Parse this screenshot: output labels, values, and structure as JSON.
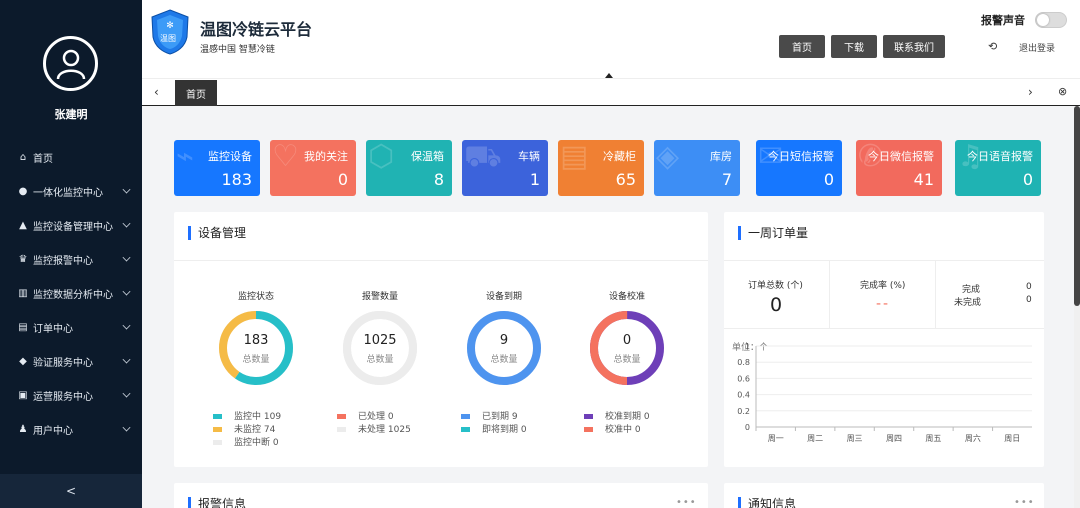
{
  "sidebar": {
    "username": "张建明",
    "items": [
      {
        "label": "首页",
        "icon": "home-icon",
        "glyph": "⌂",
        "has_children": false
      },
      {
        "label": "一体化监控中心",
        "icon": "info-icon",
        "glyph": "●",
        "has_children": true
      },
      {
        "label": "监控设备管理中心",
        "icon": "device-icon",
        "glyph": "▲",
        "has_children": true
      },
      {
        "label": "监控报警中心",
        "icon": "alarm-icon",
        "glyph": "♛",
        "has_children": true
      },
      {
        "label": "监控数据分析中心",
        "icon": "bar-chart-icon",
        "glyph": "▥",
        "has_children": true
      },
      {
        "label": "订单中心",
        "icon": "order-icon",
        "glyph": "▤",
        "has_children": true
      },
      {
        "label": "验证服务中心",
        "icon": "shield-icon",
        "glyph": "◆",
        "has_children": true
      },
      {
        "label": "运营服务中心",
        "icon": "monitor-icon",
        "glyph": "▣",
        "has_children": true
      },
      {
        "label": "用户中心",
        "icon": "users-icon",
        "glyph": "♟",
        "has_children": true
      }
    ],
    "collapse_glyph": "<"
  },
  "header": {
    "logo_text": "温图",
    "title": "温图冷链云平台",
    "subtitle": "温感中国 智慧冷链",
    "buttons": [
      "首页",
      "下载",
      "联系我们"
    ],
    "alarm_sound_label": "报警声音",
    "alarm_sound_on": false,
    "logout_label": "退出登录"
  },
  "tabs": {
    "items": [
      "首页"
    ],
    "active": "首页"
  },
  "stats": [
    {
      "label": "监控设备",
      "value": "183",
      "color": "#1677ff",
      "icon": "monitor-device-icon",
      "glyph": "⌁"
    },
    {
      "label": "我的关注",
      "value": "0",
      "color": "#f4725f",
      "icon": "heart-icon",
      "glyph": "♡"
    },
    {
      "label": "保温箱",
      "value": "8",
      "color": "#20b3b3",
      "icon": "box-icon",
      "glyph": "⬡"
    },
    {
      "label": "车辆",
      "value": "1",
      "color": "#3c63db",
      "icon": "truck-icon",
      "glyph": "⛟"
    },
    {
      "label": "冷藏柜",
      "value": "65",
      "color": "#f08033",
      "icon": "cabinet-icon",
      "glyph": "▤"
    },
    {
      "label": "库房",
      "value": "7",
      "color": "#3d8ef5",
      "icon": "warehouse-icon",
      "glyph": "◈"
    },
    {
      "label": "今日短信报警",
      "value": "0",
      "color": "#1677ff",
      "icon": "sms-icon",
      "glyph": "✉"
    },
    {
      "label": "今日微信报警",
      "value": "41",
      "color": "#f26a5d",
      "icon": "wechat-icon",
      "glyph": "✆"
    },
    {
      "label": "今日语音报警",
      "value": "0",
      "color": "#1fb3b3",
      "icon": "voice-icon",
      "glyph": "♫"
    }
  ],
  "device_panel": {
    "title": "设备管理",
    "center_caption": "总数量",
    "donuts": [
      {
        "title": "监控状态",
        "total": "183",
        "segments": [
          {
            "label": "监控中",
            "value": 109,
            "color": "#26bfc8"
          },
          {
            "label": "未监控",
            "value": 74,
            "color": "#f5bb46"
          },
          {
            "label": "监控中断",
            "value": 0,
            "color": "#ececec"
          }
        ]
      },
      {
        "title": "报警数量",
        "total": "1025",
        "segments": [
          {
            "label": "已处理",
            "value": 0,
            "color": "#f4725f"
          },
          {
            "label": "未处理",
            "value": 1025,
            "color": "#ececec"
          }
        ]
      },
      {
        "title": "设备到期",
        "total": "9",
        "segments": [
          {
            "label": "已到期",
            "value": 9,
            "color": "#4e94ef"
          },
          {
            "label": "即将到期",
            "value": 0,
            "color": "#26bfc8"
          }
        ]
      },
      {
        "title": "设备校准",
        "total": "0",
        "segments": [
          {
            "label": "校准到期",
            "value": 0,
            "color": "#6e3fb8"
          },
          {
            "label": "校准中",
            "value": 0,
            "color": "#f4725f"
          }
        ]
      }
    ]
  },
  "order_panel": {
    "title": "一周订单量",
    "total_label": "订单总数 (个)",
    "total_value": "0",
    "rate_label": "完成率 (%)",
    "rate_value": "--",
    "done_label": "完成",
    "done_value": "0",
    "undone_label": "未完成",
    "undone_value": "0"
  },
  "chart_data": {
    "type": "bar",
    "ylabel": "单位：个",
    "categories": [
      "周一",
      "周二",
      "周三",
      "周四",
      "周五",
      "周六",
      "周日"
    ],
    "values": [
      0,
      0,
      0,
      0,
      0,
      0,
      0
    ],
    "ylim": [
      0,
      1
    ],
    "yticks": [
      "0",
      "0.2",
      "0.4",
      "0.6",
      "0.8",
      "1"
    ],
    "grid": true
  },
  "bottom": {
    "alarm_title": "报警信息",
    "notice_title": "通知信息"
  }
}
